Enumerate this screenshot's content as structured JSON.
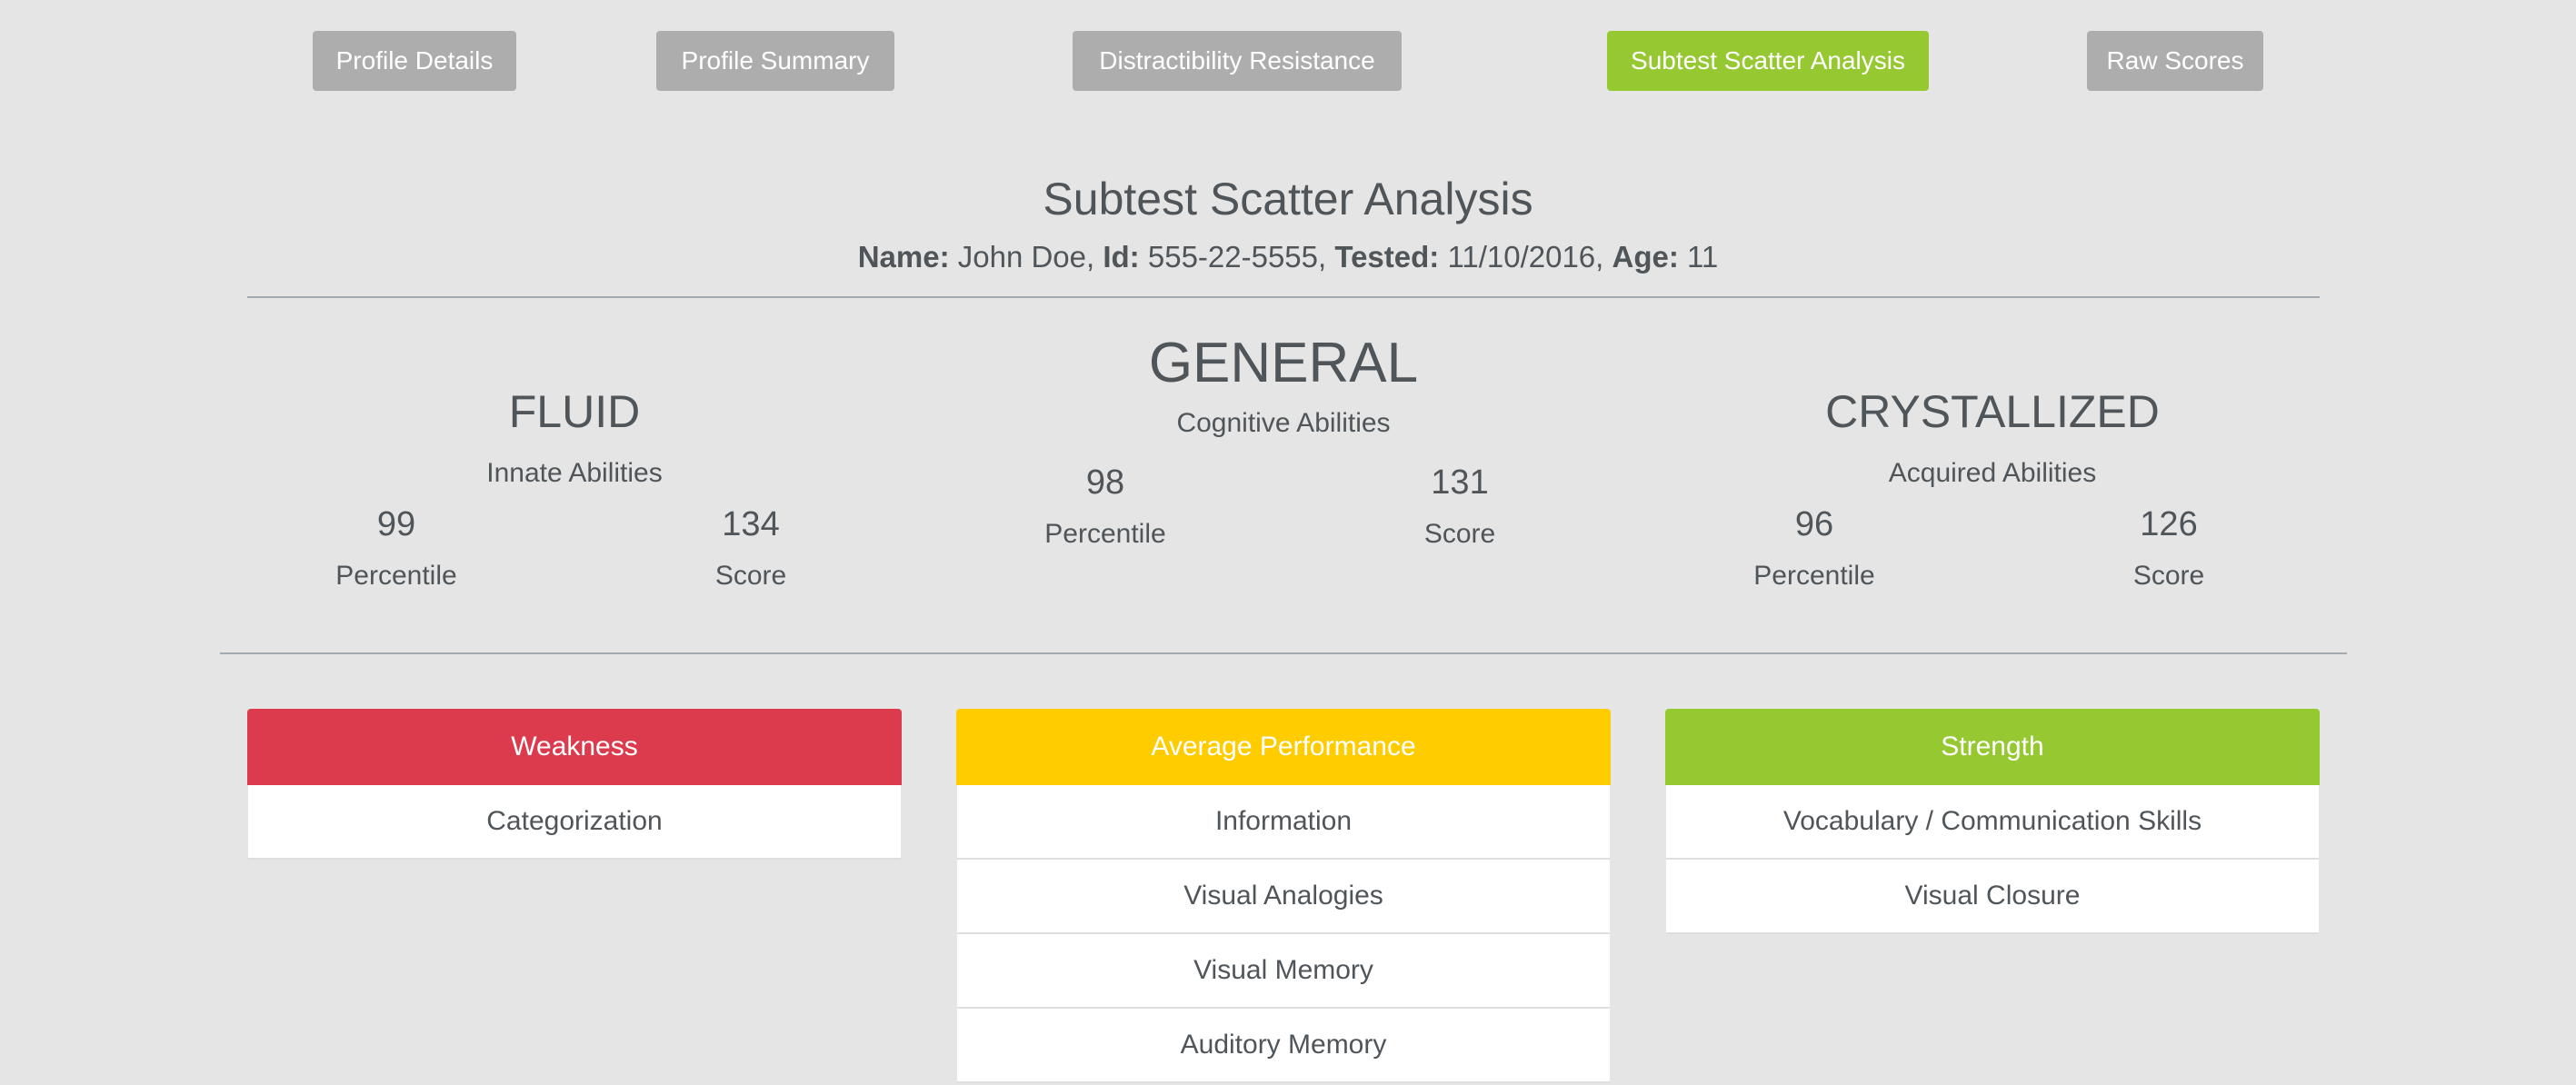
{
  "nav": {
    "buttons": [
      {
        "label": "Profile Details",
        "active": false
      },
      {
        "label": "Profile Summary",
        "active": false
      },
      {
        "label": "Distractibility Resistance",
        "active": false
      },
      {
        "label": "Subtest Scatter Analysis",
        "active": true
      },
      {
        "label": "Raw Scores",
        "active": false
      }
    ]
  },
  "header": {
    "title": "Subtest Scatter Analysis",
    "name_label": "Name:",
    "name_value": "John Doe,",
    "id_label": "Id:",
    "id_value": "555-22-5555,",
    "tested_label": "Tested:",
    "tested_value": "11/10/2016,",
    "age_label": "Age:",
    "age_value": "11"
  },
  "abilities": {
    "fluid": {
      "title": "FLUID",
      "subtitle": "Innate Abilities",
      "percentile": "99",
      "score": "134",
      "percentile_label": "Percentile",
      "score_label": "Score"
    },
    "general": {
      "title": "GENERAL",
      "subtitle": "Cognitive Abilities",
      "percentile": "98",
      "score": "131",
      "percentile_label": "Percentile",
      "score_label": "Score"
    },
    "crystallized": {
      "title": "CRYSTALLIZED",
      "subtitle": "Acquired Abilities",
      "percentile": "96",
      "score": "126",
      "percentile_label": "Percentile",
      "score_label": "Score"
    }
  },
  "cards": {
    "weakness": {
      "title": "Weakness",
      "color": "#dc3b4e",
      "items": [
        "Categorization"
      ]
    },
    "average": {
      "title": "Average Performance",
      "color": "#ffcc00",
      "items": [
        "Information",
        "Visual Analogies",
        "Visual Memory",
        "Auditory Memory"
      ]
    },
    "strength": {
      "title": "Strength",
      "color": "#96c832",
      "items": [
        "Vocabulary / Communication Skills",
        "Visual Closure"
      ]
    }
  }
}
